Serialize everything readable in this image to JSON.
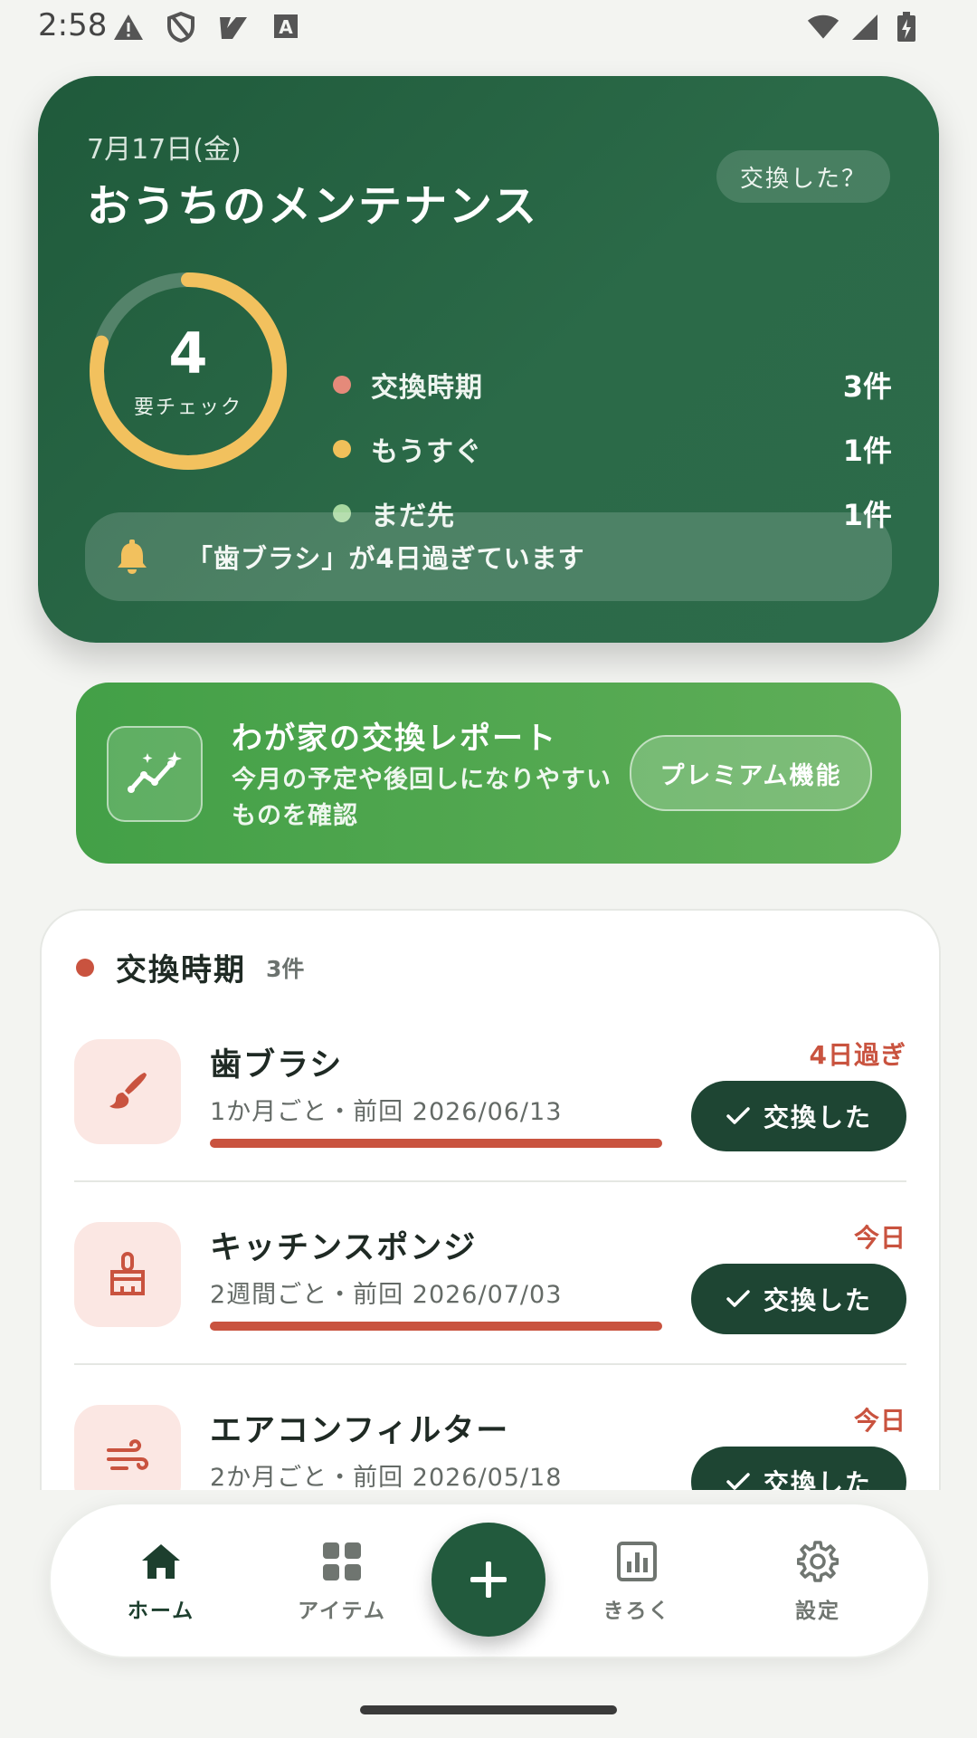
{
  "status_bar": {
    "time": "2:58"
  },
  "hero": {
    "date": "7月17日(金)",
    "title": "おうちのメンテナンス",
    "action_label": "交換した？",
    "ring": {
      "count": "4",
      "label": "要チェック",
      "progress": 0.8
    },
    "stats": [
      {
        "label": "交換時期",
        "count": "3件",
        "color": "#e58a7a"
      },
      {
        "label": "もうすぐ",
        "count": "1件",
        "color": "#f0c05a"
      },
      {
        "label": "まだ先",
        "count": "1件",
        "color": "#a8d8a0"
      }
    ],
    "alert_text": "「歯ブラシ」が4日過ぎています"
  },
  "report": {
    "title": "わが家の交換レポート",
    "description": "今月の予定や後回しになりやすいものを確認",
    "button_label": "プレミアム機能"
  },
  "section": {
    "title": "交換時期",
    "count": "3件",
    "items": [
      {
        "name": "歯ブラシ",
        "meta": "1か月ごと・前回 2026/06/13",
        "status": "4日過ぎ",
        "button": "交換した",
        "icon": "brush-icon",
        "progress": 1.0
      },
      {
        "name": "キッチンスポンジ",
        "meta": "2週間ごと・前回 2026/07/03",
        "status": "今日",
        "button": "交換した",
        "icon": "cleaning-brush-icon",
        "progress": 1.0
      },
      {
        "name": "エアコンフィルター",
        "meta": "2か月ごと・前回 2026/05/18",
        "status": "今日",
        "button": "交換した",
        "icon": "air-wind-icon",
        "progress": 1.0
      }
    ]
  },
  "nav": {
    "items": [
      {
        "label": "ホーム",
        "icon": "home-icon",
        "active": true
      },
      {
        "label": "アイテム",
        "icon": "grid-icon",
        "active": false
      },
      {
        "label": "きろく",
        "icon": "chart-icon",
        "active": false
      },
      {
        "label": "設定",
        "icon": "gear-icon",
        "active": false
      }
    ],
    "fab_icon": "plus-icon"
  },
  "colors": {
    "hero_green": "#225a3d",
    "accent_red": "#c9533f",
    "report_green": "#4caf50",
    "button_dark": "#1e4533"
  }
}
